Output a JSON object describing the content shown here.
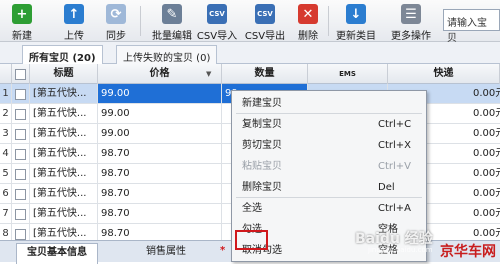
{
  "toolbar": {
    "new_label": "新建",
    "upload_label": "上传",
    "sync_label": "同步",
    "batch_edit_label": "批量编辑",
    "csv_import_label": "CSV导入",
    "csv_export_label": "CSV导出",
    "delete_label": "删除",
    "update_category_label": "更新类目",
    "more_label": "更多操作",
    "search_placeholder": "请输入宝贝",
    "csv_text": "CSV"
  },
  "tabs": {
    "all_items": "所有宝贝 (20)",
    "upload_failed": "上传失败的宝贝 (0)"
  },
  "table": {
    "headers": [
      "标题",
      "价格",
      "数量",
      "EMS",
      "快递"
    ],
    "rows": [
      {
        "num": "1",
        "title": "[第五代快...",
        "price": "99.00",
        "qty": "99",
        "extra": "0.00元",
        "selected": true
      },
      {
        "num": "2",
        "title": "[第五代快...",
        "price": "99.00",
        "qty": "",
        "extra": "0.00元",
        "selected": false
      },
      {
        "num": "3",
        "title": "[第五代快...",
        "price": "99.00",
        "qty": "",
        "extra": "0.00元",
        "selected": false
      },
      {
        "num": "4",
        "title": "[第五代快...",
        "price": "98.70",
        "qty": "",
        "extra": "0.00元",
        "selected": false
      },
      {
        "num": "5",
        "title": "[第五代快...",
        "price": "98.70",
        "qty": "",
        "extra": "0.00元",
        "selected": false
      },
      {
        "num": "6",
        "title": "[第五代快...",
        "price": "98.70",
        "qty": "",
        "extra": "0.00元",
        "selected": false
      },
      {
        "num": "7",
        "title": "[第五代快...",
        "price": "98.70",
        "qty": "",
        "extra": "0.00元",
        "selected": false
      },
      {
        "num": "8",
        "title": "[第五代快...",
        "price": "98.70",
        "qty": "",
        "extra": "0.00元",
        "selected": false
      }
    ]
  },
  "bottom_tabs": {
    "basic": "宝贝基本信息",
    "sales": "销售属性",
    "star": "*"
  },
  "context_menu": {
    "items": [
      {
        "label": "新建宝贝",
        "key": "",
        "disabled": false
      },
      {
        "label": "复制宝贝",
        "key": "Ctrl+C",
        "disabled": false
      },
      {
        "label": "剪切宝贝",
        "key": "Ctrl+X",
        "disabled": false
      },
      {
        "label": "粘贴宝贝",
        "key": "Ctrl+V",
        "disabled": true
      },
      {
        "label": "删除宝贝",
        "key": "Del",
        "disabled": false
      },
      {
        "label": "全选",
        "key": "Ctrl+A",
        "disabled": false
      },
      {
        "label": "勾选",
        "key": "空格",
        "disabled": false
      },
      {
        "label": "取消勾选",
        "key": "空格",
        "disabled": false
      }
    ]
  },
  "watermark": {
    "text": "Baidu 经验",
    "text2": "京华车网",
    "url": "jingyan.baidu.com"
  },
  "colors": {
    "selection": "#1f6fd6",
    "highlight_box": "#d0181c",
    "new_icon": "#2e9e34",
    "upload_icon": "#2b7dd0",
    "delete_icon": "#d63a2f"
  }
}
